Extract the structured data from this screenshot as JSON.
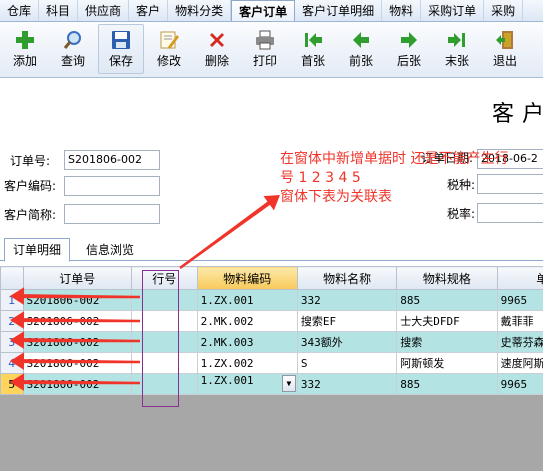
{
  "menu": [
    "仓库",
    "科目",
    "供应商",
    "客户",
    "物料分类",
    "客户订单",
    "客户订单明细",
    "物料",
    "采购订单",
    "采购"
  ],
  "menu_active": 5,
  "toolbar": [
    {
      "label": "添加",
      "icon": "plus-icon",
      "color": "#2f9e2f"
    },
    {
      "label": "查询",
      "icon": "magnifier-icon",
      "color": "#3a6fc0"
    },
    {
      "label": "保存",
      "icon": "floppy-disk-icon",
      "color": "#2b5fae"
    },
    {
      "label": "修改",
      "icon": "edit-pencil-icon",
      "color": "#d69a1c"
    },
    {
      "label": "删除",
      "icon": "delete-x-icon",
      "color": "#d42a1f"
    },
    {
      "label": "打印",
      "icon": "printer-icon",
      "color": "#666666"
    },
    {
      "label": "首张",
      "icon": "first-arrow-icon",
      "color": "#2f9e2f"
    },
    {
      "label": "前张",
      "icon": "previous-arrow-icon",
      "color": "#2f9e2f"
    },
    {
      "label": "后张",
      "icon": "next-arrow-icon",
      "color": "#2f9e2f"
    },
    {
      "label": "末张",
      "icon": "last-arrow-icon",
      "color": "#2f9e2f"
    },
    {
      "label": "退出",
      "icon": "exit-door-icon",
      "color": "#c9a227"
    }
  ],
  "form": {
    "title": "客户",
    "order_no_label": "订单号:",
    "order_no_value": "S201806-002",
    "customer_code_label": "客户编码:",
    "customer_code_value": "",
    "customer_abbr_label": "客户简称:",
    "customer_abbr_value": "",
    "order_date_label": "订单日期:",
    "order_date_value": "2018-06-2",
    "tax_type_label": "税种:",
    "tax_rate_label": "税率:"
  },
  "tabs": [
    "订单明细",
    "信息浏览"
  ],
  "grid": {
    "columns": [
      "订单号",
      "行号",
      "物料编码",
      "物料名称",
      "物料规格",
      "单位"
    ],
    "rows": [
      {
        "num": "1",
        "order": "S201806-002",
        "line": "",
        "code": "1.ZX.001",
        "name": "332",
        "spec": "885",
        "unit": "9965"
      },
      {
        "num": "2",
        "order": "S201806-002",
        "line": "",
        "code": "2.MK.002",
        "name": "搜索EF",
        "spec": "士大夫DFDF",
        "unit": "戴菲菲"
      },
      {
        "num": "3",
        "order": "S201806-002",
        "line": "",
        "code": "2.MK.003",
        "name": "343额外",
        "spec": "搜索",
        "unit": "史蒂芬森"
      },
      {
        "num": "4",
        "order": "S201806-002",
        "line": "",
        "code": "1.ZX.002",
        "name": "S",
        "spec": "阿斯顿发",
        "unit": "速度阿斯"
      },
      {
        "num": "5",
        "order": "S201806-002",
        "line": "",
        "code": "1.ZX.001",
        "name": "332",
        "spec": "885",
        "unit": "9965"
      }
    ]
  },
  "annotation": {
    "line1": "在窗体中新增单据时 还是不能产生行",
    "line2": "号 1 2 3 4 5",
    "line3": "窗体下表为关联表",
    "color": "#f0342a"
  }
}
